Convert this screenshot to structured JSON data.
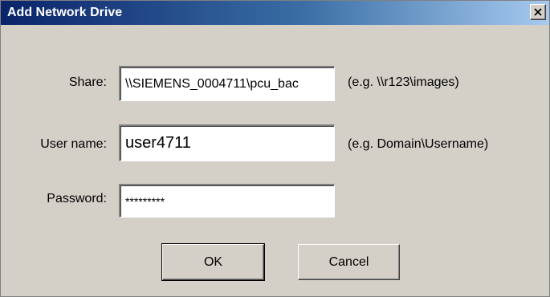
{
  "window": {
    "title": "Add Network Drive",
    "close_icon": "close-icon"
  },
  "form": {
    "share": {
      "label": "Share:",
      "value": "\\\\SIEMENS_0004711\\pcu_bac",
      "hint": "(e.g. \\\\r123\\images)"
    },
    "username": {
      "label": "User name:",
      "value": "user4711",
      "hint": "(e.g. Domain\\Username)"
    },
    "password": {
      "label": "Password:",
      "value": "*********"
    }
  },
  "buttons": {
    "ok_label": "OK",
    "cancel_label": "Cancel"
  }
}
